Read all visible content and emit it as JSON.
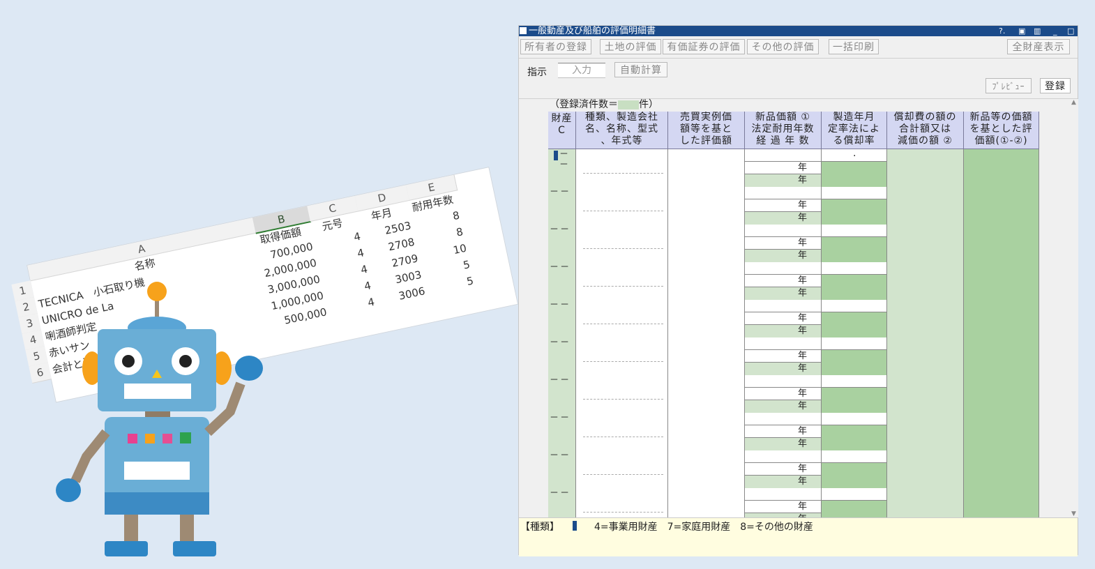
{
  "spreadsheet": {
    "columns": [
      "A",
      "B",
      "C",
      "D",
      "E"
    ],
    "row_numbers": [
      "1",
      "2",
      "3",
      "4",
      "5",
      "6"
    ],
    "header_row": [
      "名称",
      "取得価額",
      "元号",
      "年月",
      "耐用年数"
    ],
    "rows": [
      [
        "TECNICA　小石取り機",
        "700,000",
        "4",
        "2503",
        "8"
      ],
      [
        "UNICRO de La",
        "2,000,000",
        "4",
        "2708",
        "8"
      ],
      [
        "唎酒師判定",
        "3,000,000",
        "4",
        "2709",
        "10"
      ],
      [
        "赤いサン",
        "1,000,000",
        "4",
        "3003",
        "5"
      ],
      [
        "会計と決算",
        "500,000",
        "4",
        "3006",
        "5"
      ]
    ]
  },
  "window": {
    "title": "一般動産及び船舶の評価明細書",
    "title_controls": [
      "?.",
      "▣",
      "▥",
      "_",
      "□"
    ],
    "toolbar": {
      "owner_reg": "所有者の登録",
      "land_eval": "土地の評価",
      "securities_eval": "有価証券の評価",
      "other_eval": "その他の評価",
      "bulk_print": "一括印刷",
      "all_assets": "全財産表示"
    },
    "instruction_label": "指示",
    "instruction_value": "入力",
    "auto_calc": "自動計算",
    "preview": "ﾌﾟﾚﾋﾞｭｰ",
    "register": "登録",
    "reg_count_prefix": "（登録済件数＝",
    "reg_count_suffix": "件）",
    "headers": {
      "col1": "財産\nC",
      "col2": "種類、製造会社\n名、名称、型式\n、年式等",
      "col3": "売買実例価\n額等を基と\nした評価額",
      "col4": "新品価額 ①\n法定耐用年数\n経 過 年 数",
      "col5": "製造年月\n定率法によ\nる償却率",
      "col6": "償却費の額の\n合計額又は\n減価の額 ②",
      "col7": "新品等の価額\nを基とした評\n価額(①-②)"
    },
    "row_marker": "－ －",
    "year_unit": "年",
    "rate_dot": ".",
    "row_count": 10,
    "footer": {
      "label": "【種類】",
      "options": "4=事業用財産　7=家庭用財産　8=その他の財産"
    }
  }
}
